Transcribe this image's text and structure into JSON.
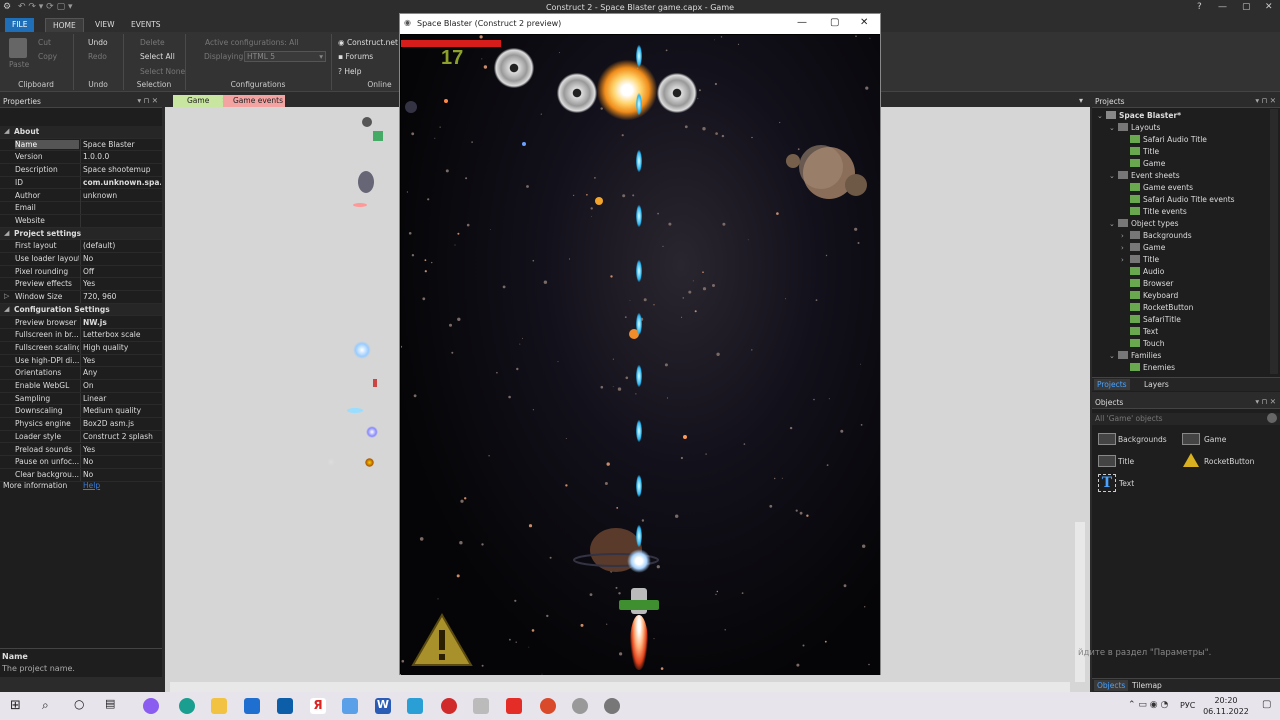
{
  "window": {
    "title": "Construct 2 - Space Blaster game.capx - Game"
  },
  "ribbon_tabs": [
    "FILE",
    "HOME",
    "VIEW",
    "EVENTS"
  ],
  "ribbon": {
    "clipboard": {
      "paste": "Paste",
      "cut": "Cut",
      "copy": "Copy",
      "group": "Clipboard"
    },
    "undo": {
      "undo": "Undo",
      "redo": "Redo",
      "group": "Undo"
    },
    "selection": {
      "delete": "Delete",
      "select_all": "Select All",
      "select_none": "Select None",
      "group": "Selection"
    },
    "configurations": {
      "active": "Active configurations: All",
      "displaying_label": "Displaying:",
      "displaying_value": "HTML 5",
      "group": "Configurations"
    },
    "online": {
      "construct_net": "Construct.net",
      "forums": "Forums",
      "help": "Help",
      "group": "Online"
    }
  },
  "properties": {
    "title": "Properties",
    "rows": [
      {
        "k": "About",
        "section": true
      },
      {
        "k": "Name",
        "v": "Space Blaster",
        "selected": true
      },
      {
        "k": "Version",
        "v": "1.0.0.0"
      },
      {
        "k": "Description",
        "v": "Space shootemup"
      },
      {
        "k": "ID",
        "v": "com.unknown.spa...",
        "bold": true
      },
      {
        "k": "Author",
        "v": "unknown"
      },
      {
        "k": "Email",
        "v": ""
      },
      {
        "k": "Website",
        "v": ""
      },
      {
        "k": "Project settings",
        "section": true
      },
      {
        "k": "First layout",
        "v": "(default)"
      },
      {
        "k": "Use loader layout",
        "v": "No"
      },
      {
        "k": "Pixel rounding",
        "v": "Off"
      },
      {
        "k": "Preview effects",
        "v": "Yes"
      },
      {
        "k": "Window Size",
        "v": "720, 960",
        "expand": true
      },
      {
        "k": "Configuration Settings",
        "section": true
      },
      {
        "k": "Preview browser",
        "v": "NW.js",
        "bold": true
      },
      {
        "k": "Fullscreen in br...",
        "v": "Letterbox scale"
      },
      {
        "k": "Fullscreen scaling",
        "v": "High quality"
      },
      {
        "k": "Use high-DPI di...",
        "v": "Yes"
      },
      {
        "k": "Orientations",
        "v": "Any"
      },
      {
        "k": "Enable WebGL",
        "v": "On"
      },
      {
        "k": "Sampling",
        "v": "Linear"
      },
      {
        "k": "Downscaling",
        "v": "Medium quality"
      },
      {
        "k": "Physics engine",
        "v": "Box2D asm.js"
      },
      {
        "k": "Loader style",
        "v": "Construct 2 splash"
      },
      {
        "k": "Preload sounds",
        "v": "Yes"
      },
      {
        "k": "Pause on unfoc...",
        "v": "No"
      },
      {
        "k": "Clear backgrou...",
        "v": "No"
      }
    ],
    "more_info": "More information",
    "more_info_link": "Help",
    "desc_title": "Name",
    "desc_text": "The project name."
  },
  "doc_tabs": [
    "Game",
    "Game events"
  ],
  "preview": {
    "title": "Space Blaster (Construct 2 preview)",
    "score": "17",
    "health_pct": 100
  },
  "projects": {
    "title": "Projects",
    "tree": [
      {
        "label": "Space Blaster*",
        "level": 0,
        "bold": true
      },
      {
        "label": "Layouts",
        "level": 1,
        "folder": true
      },
      {
        "label": "Safari Audio Title",
        "level": 2
      },
      {
        "label": "Title",
        "level": 2
      },
      {
        "label": "Game",
        "level": 2
      },
      {
        "label": "Event sheets",
        "level": 1,
        "folder": true
      },
      {
        "label": "Game events",
        "level": 2
      },
      {
        "label": "Safari Audio Title events",
        "level": 2
      },
      {
        "label": "Title events",
        "level": 2
      },
      {
        "label": "Object types",
        "level": 1,
        "folder": true
      },
      {
        "label": "Backgrounds",
        "level": 2,
        "folder": true
      },
      {
        "label": "Game",
        "level": 2,
        "folder": true
      },
      {
        "label": "Title",
        "level": 2,
        "folder": true
      },
      {
        "label": "Audio",
        "level": 2
      },
      {
        "label": "Browser",
        "level": 2
      },
      {
        "label": "Keyboard",
        "level": 2
      },
      {
        "label": "RocketButton",
        "level": 2
      },
      {
        "label": "SafariTitle",
        "level": 2
      },
      {
        "label": "Text",
        "level": 2
      },
      {
        "label": "Touch",
        "level": 2
      },
      {
        "label": "Families",
        "level": 1,
        "folder": true
      },
      {
        "label": "Enemies",
        "level": 2
      }
    ],
    "tabs": [
      "Projects",
      "Layers"
    ]
  },
  "objects": {
    "title": "Objects",
    "filter": "All 'Game' objects",
    "items": [
      "Backgrounds",
      "Game",
      "Title",
      "RocketButton",
      "Text"
    ],
    "tabs": [
      "Objects",
      "Tilemap"
    ]
  },
  "activation_text": "йдите в раздел \"Параметры\".",
  "taskbar": {
    "lang": "РУС",
    "time": "20:20",
    "date": "06.11.2022"
  }
}
